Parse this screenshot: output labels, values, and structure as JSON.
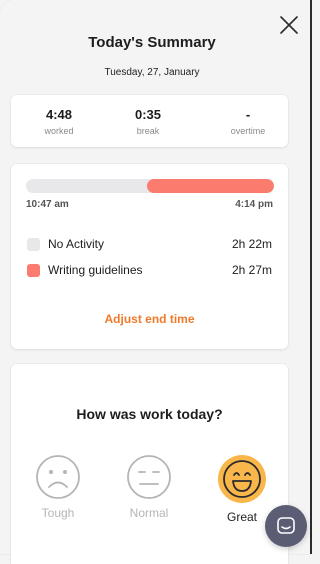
{
  "header": {
    "title": "Today's Summary",
    "date": "Tuesday, 27, January"
  },
  "stats": [
    {
      "value": "4:48",
      "label": "worked"
    },
    {
      "value": "0:35",
      "label": "break"
    },
    {
      "value": "-",
      "label": "overtime"
    }
  ],
  "timeline": {
    "start": "10:47 am",
    "end": "4:14 pm",
    "activities": [
      {
        "name": "No Activity",
        "duration": "2h 22m",
        "color": "#e8e8ea"
      },
      {
        "name": "Writing guidelines",
        "duration": "2h 27m",
        "color": "#fb7b6e"
      }
    ],
    "adjust_label": "Adjust end time"
  },
  "mood": {
    "question": "How was work today?",
    "options": [
      {
        "label": "Tough",
        "selected": false
      },
      {
        "label": "Normal",
        "selected": false
      },
      {
        "label": "Great",
        "selected": true
      }
    ],
    "selected_color": "#f9b64a"
  },
  "colors": {
    "accent": "#f07a2c",
    "activity": "#fb7b6e"
  }
}
